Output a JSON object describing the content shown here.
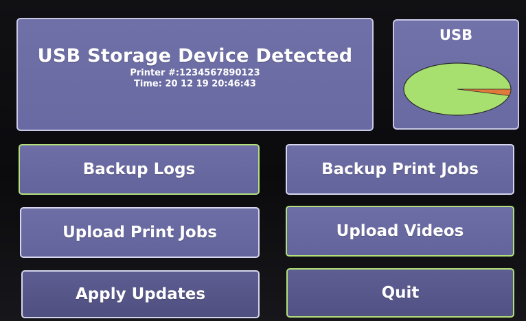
{
  "info": {
    "title": "USB Storage Device Detected",
    "printer_line": "Printer #:1234567890123",
    "time_line": "Time: 20 12 19 20:46:43"
  },
  "usb": {
    "label": "USB",
    "used_fraction": 0.04,
    "free_color": "#a8e070",
    "used_color": "#e07a3a"
  },
  "buttons": {
    "backup_logs": "Backup Logs",
    "backup_print_jobs": "Backup Print Jobs",
    "upload_print_jobs": "Upload Print Jobs",
    "upload_videos": "Upload Videos",
    "apply_updates": "Apply Updates",
    "quit": "Quit"
  }
}
